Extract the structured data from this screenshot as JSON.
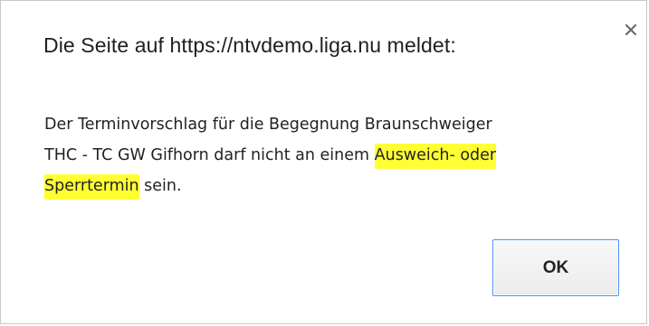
{
  "dialog": {
    "title": "Die Seite auf https://ntvdemo.liga.nu meldet:",
    "close_icon": "close-icon",
    "message": {
      "line1": "Der Terminvorschlag für die Begegnung Braunschweiger",
      "line2_prefix": "THC - TC GW Gifhorn darf nicht an einem ",
      "line2_highlight": "Ausweich- oder",
      "line3_highlight": "Sperrtermin",
      "line3_suffix": " sein."
    },
    "ok_label": "OK",
    "colors": {
      "highlight": "#ffff33",
      "button_border": "#4d90fe",
      "dialog_border": "#c8c8c8"
    }
  }
}
